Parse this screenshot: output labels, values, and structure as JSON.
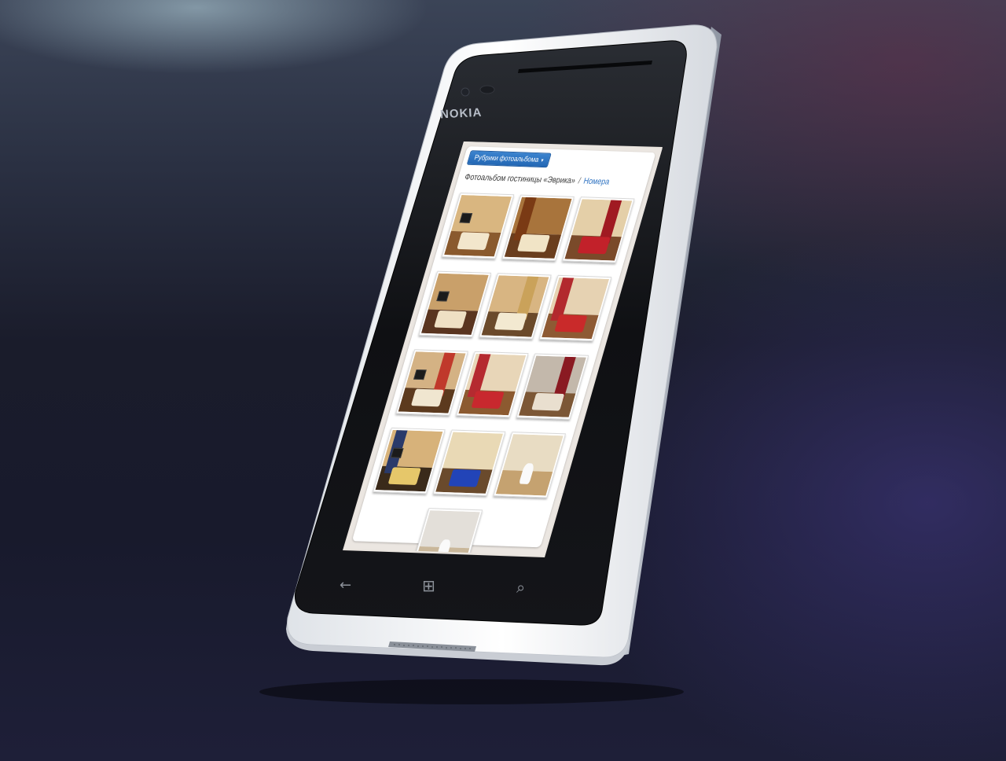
{
  "device": {
    "brand": "NOKIA",
    "nav_buttons": [
      {
        "name": "back-icon",
        "glyph": "←"
      },
      {
        "name": "windows-icon",
        "glyph": "⊞"
      },
      {
        "name": "search-icon",
        "glyph": "⌕"
      }
    ]
  },
  "page": {
    "rubric_button_label": "Рубрики фотоальбома",
    "rubric_caret": "▾",
    "breadcrumb": {
      "parent": "Фотоальбом гостиницы «Эврика»",
      "separator": "/",
      "current": "Номера"
    }
  },
  "gallery": {
    "photos": [
      {
        "wall": "#d9b680",
        "floor": "#8a5a2e",
        "bed": "#f2e6cc",
        "curtain": ""
      },
      {
        "wall": "#a8743c",
        "floor": "#6a3e1e",
        "bed": "#f1e4c6",
        "curtain": "#7a3a14"
      },
      {
        "wall": "#e4cfa8",
        "floor": "#7a4a2a",
        "bed": "#c2212a",
        "curtain": "#a01a22"
      },
      {
        "wall": "#c9a06a",
        "floor": "#5a3520",
        "bed": "#efe0c4",
        "curtain": ""
      },
      {
        "wall": "#d8b582",
        "floor": "#6b4a2b",
        "bed": "#f3e9d1",
        "curtain": "#caa25a"
      },
      {
        "wall": "#e6d2b2",
        "floor": "#8e5a34",
        "bed": "#c92a2a",
        "curtain": "#b22a2e"
      },
      {
        "wall": "#d4b284",
        "floor": "#5c3a1e",
        "bed": "#f0e6d0",
        "curtain": "#c0392b"
      },
      {
        "wall": "#e8d6b8",
        "floor": "#8c5a30",
        "bed": "#c8282e",
        "curtain": "#b52a30"
      },
      {
        "wall": "#c3b8ab",
        "floor": "#7c5736",
        "bed": "#e9dfcf",
        "curtain": "#8a1a22"
      },
      {
        "wall": "#d7b27a",
        "floor": "#3a2a1a",
        "bed": "#e6c76a",
        "curtain": "#2a3a6a"
      },
      {
        "wall": "#e9d9b5",
        "floor": "#6a4a2c",
        "bed": "#2244b8",
        "curtain": ""
      },
      {
        "wall": "#e8dcc3",
        "floor": "#c5a270",
        "bed": "#f5efe4",
        "curtain": ""
      },
      {
        "wall": "#e3dfd9",
        "floor": "#c9b79a",
        "bed": "#f7f4ef",
        "curtain": ""
      }
    ]
  }
}
